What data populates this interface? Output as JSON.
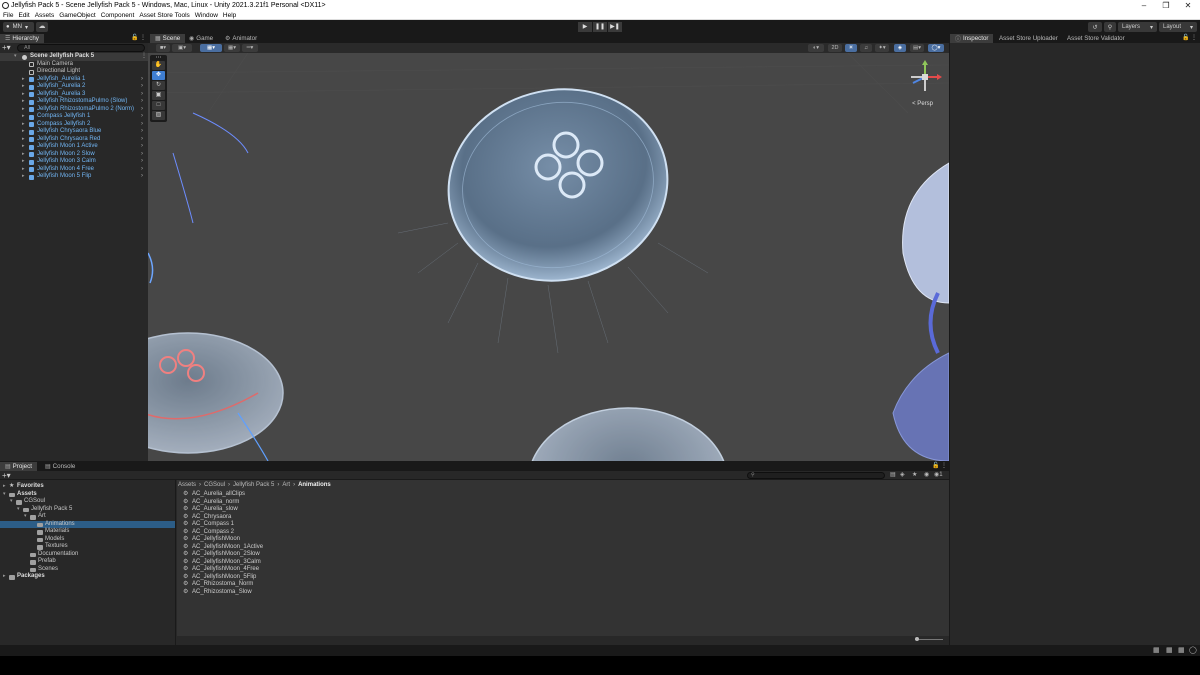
{
  "window": {
    "title": "Jellyfish Pack 5 - Scene Jellyfish Pack 5 - Windows, Mac, Linux - Unity 2021.3.21f1 Personal <DX11>",
    "minimize_icon": "minimize-icon",
    "maximize_icon": "restore-icon",
    "close_icon": "close-icon"
  },
  "menu": [
    "File",
    "Edit",
    "Assets",
    "GameObject",
    "Component",
    "Asset Store Tools",
    "Window",
    "Help"
  ],
  "toolbar": {
    "account_label": "MN",
    "layers_label": "Layers",
    "layout_label": "Layout"
  },
  "hierarchy": {
    "tab_label": "Hierarchy",
    "search_placeholder": "All",
    "scene_name": "Scene Jellyfish Pack 5",
    "items": [
      {
        "label": "Main Camera",
        "type": "gameobject"
      },
      {
        "label": "Directional Light",
        "type": "gameobject"
      },
      {
        "label": "Jellyfish_Aurelia 1",
        "type": "prefab"
      },
      {
        "label": "Jellyfish_Aurelia 2",
        "type": "prefab"
      },
      {
        "label": "Jellyfish_Aurelia 3",
        "type": "prefab"
      },
      {
        "label": "Jellyfish RhizostomaPulmo (Slow)",
        "type": "prefab"
      },
      {
        "label": "Jellyfish RhizostomaPulmo 2 (Norm)",
        "type": "prefab"
      },
      {
        "label": "Compass Jellyfish 1",
        "type": "prefab"
      },
      {
        "label": "Compass Jellyfish 2",
        "type": "prefab"
      },
      {
        "label": "Jellyfish Chrysaora Blue",
        "type": "prefab"
      },
      {
        "label": "Jellyfish Chrysaora Red",
        "type": "prefab"
      },
      {
        "label": "Jellyfish Moon 1 Active",
        "type": "prefab"
      },
      {
        "label": "Jellyfish Moon 2 Slow",
        "type": "prefab"
      },
      {
        "label": "Jellyfish Moon 3 Calm",
        "type": "prefab"
      },
      {
        "label": "Jellyfish Moon 4 Free",
        "type": "prefab"
      },
      {
        "label": "Jellyfish Moon 5 Flip",
        "type": "prefab"
      }
    ]
  },
  "scene_tabs": [
    {
      "label": "Scene",
      "icon": "scene-icon",
      "active": true
    },
    {
      "label": "Game",
      "icon": "game-icon",
      "active": false
    },
    {
      "label": "Animator",
      "icon": "animator-icon",
      "active": false
    }
  ],
  "scene": {
    "mode_2d_label": "2D",
    "persp_label": "< Persp"
  },
  "inspector_tabs": [
    {
      "label": "Inspector",
      "active": true
    },
    {
      "label": "Asset Store Uploader",
      "active": false
    },
    {
      "label": "Asset Store Validator",
      "active": false
    }
  ],
  "project": {
    "tabs": [
      {
        "label": "Project",
        "active": true
      },
      {
        "label": "Console",
        "active": false
      }
    ],
    "badge": "1",
    "tree": [
      {
        "label": "Favorites",
        "depth": 0,
        "kind": "header",
        "arrow": "▸"
      },
      {
        "label": "Assets",
        "depth": 0,
        "kind": "header",
        "arrow": "▾"
      },
      {
        "label": "CGSoul",
        "depth": 1,
        "kind": "folder",
        "arrow": "▾"
      },
      {
        "label": "Jellyfish Pack 5",
        "depth": 2,
        "kind": "folder",
        "arrow": "▾"
      },
      {
        "label": "Art",
        "depth": 3,
        "kind": "folder",
        "arrow": "▾"
      },
      {
        "label": "Animations",
        "depth": 4,
        "kind": "folder",
        "arrow": "",
        "selected": true
      },
      {
        "label": "Materials",
        "depth": 4,
        "kind": "folder",
        "arrow": ""
      },
      {
        "label": "Models",
        "depth": 4,
        "kind": "folder",
        "arrow": ""
      },
      {
        "label": "Textures",
        "depth": 4,
        "kind": "folder",
        "arrow": ""
      },
      {
        "label": "Documentation",
        "depth": 3,
        "kind": "folder",
        "arrow": ""
      },
      {
        "label": "Prefab",
        "depth": 3,
        "kind": "folder",
        "arrow": ""
      },
      {
        "label": "Scenes",
        "depth": 3,
        "kind": "folder",
        "arrow": ""
      },
      {
        "label": "Packages",
        "depth": 0,
        "kind": "header",
        "arrow": "▸"
      }
    ],
    "breadcrumb": [
      "Assets",
      "CGSoul",
      "Jellyfish Pack 5",
      "Art",
      "Animations"
    ],
    "files": [
      "AC_Aurelia_allClips",
      "AC_Aurelia_norm",
      "AC_Aurelia_slow",
      "AC_Chrysaora",
      "AC_Compass 1",
      "AC_Compass 2",
      "AC_JellyfishMoon",
      "AC_JellyfishMoon_1Active",
      "AC_JellyfishMoon_2Slow",
      "AC_JellyfishMoon_3Calm",
      "AC_JellyfishMoon_4Free",
      "AC_JellyfishMoon_5Flip",
      "AC_Rhizostoma_Norm",
      "AC_Rhizostoma_Slow"
    ]
  }
}
